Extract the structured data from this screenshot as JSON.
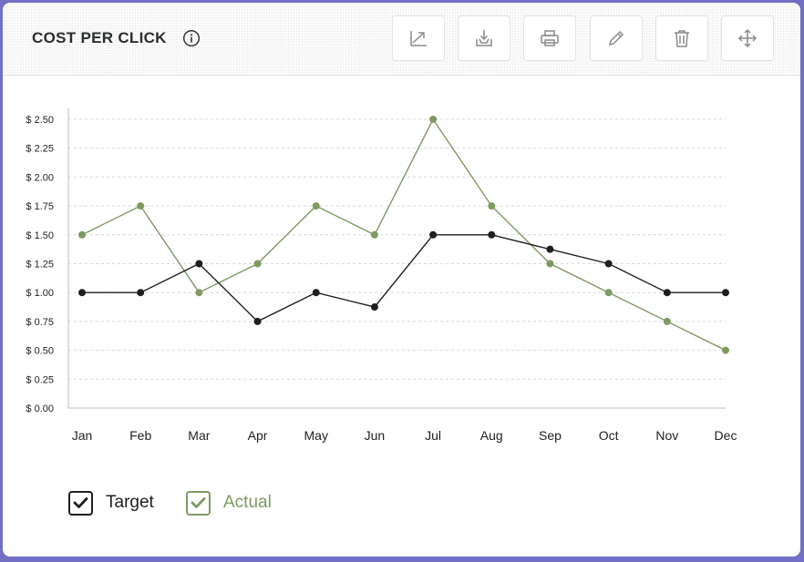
{
  "header": {
    "title": "COST PER CLICK"
  },
  "toolbar": [
    {
      "name": "trend-icon"
    },
    {
      "name": "download-icon"
    },
    {
      "name": "print-icon"
    },
    {
      "name": "edit-icon"
    },
    {
      "name": "delete-icon"
    },
    {
      "name": "move-icon"
    }
  ],
  "colors": {
    "target": "#1f1f1f",
    "actual": "#7e9a62",
    "grid": "#d9d9d9",
    "background": "#7170c4"
  },
  "chart_data": {
    "type": "line",
    "title": "COST PER CLICK",
    "xlabel": "",
    "ylabel": "",
    "categories": [
      "Jan",
      "Feb",
      "Mar",
      "Apr",
      "May",
      "Jun",
      "Jul",
      "Aug",
      "Sep",
      "Oct",
      "Nov",
      "Dec"
    ],
    "yticks": [
      0,
      0.25,
      0.5,
      0.75,
      1.0,
      1.25,
      1.5,
      1.75,
      2.0,
      2.25,
      2.5
    ],
    "ytick_labels": [
      "$ 0.00",
      "$ 0.25",
      "$ 0.50",
      "$ 0.75",
      "$ 1.00",
      "$ 1.25",
      "$ 1.50",
      "$ 1.75",
      "$ 2.00",
      "$ 2.25",
      "$ 2.50"
    ],
    "ylim": [
      0,
      2.5
    ],
    "grid": true,
    "legend_position": "bottom-left",
    "series": [
      {
        "name": "Target",
        "color": "#1f1f1f",
        "values": [
          1.0,
          1.0,
          1.25,
          0.75,
          1.0,
          0.875,
          1.5,
          1.5,
          1.375,
          1.25,
          1.0,
          1.0
        ]
      },
      {
        "name": "Actual",
        "color": "#7e9a62",
        "values": [
          1.5,
          1.75,
          1.0,
          1.25,
          1.75,
          1.5,
          2.5,
          1.75,
          1.25,
          1.0,
          0.75,
          0.5
        ]
      }
    ]
  }
}
